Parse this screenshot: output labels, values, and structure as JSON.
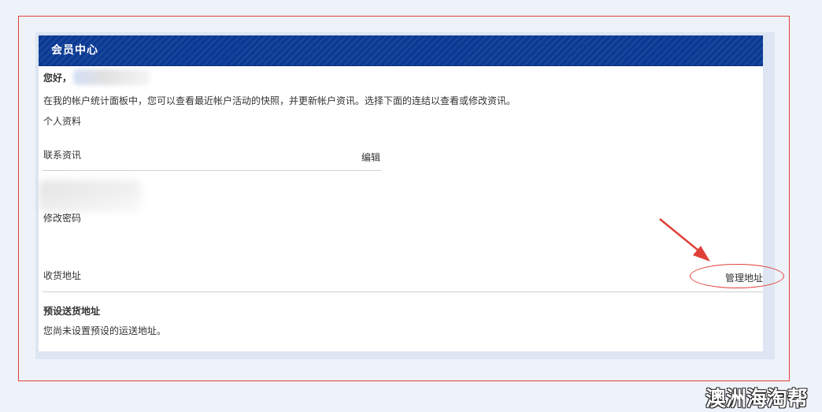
{
  "panel": {
    "title": "会员中心",
    "greeting": "您好，",
    "description": "在我的帐户统计面板中，您可以查看最近帐户活动的快照，并更新帐户资讯。选择下面的连结以查看或修改资讯。",
    "profile_label": "个人资料"
  },
  "contact": {
    "title": "联系资讯",
    "edit_label": "编辑",
    "change_password_label": "修改密码"
  },
  "address": {
    "title": "收货地址",
    "manage_label": "管理地址",
    "default_title": "预设送货地址",
    "no_default_text": "您尚未设置预设的运送地址。"
  },
  "watermark": {
    "text": "澳洲海淘帮"
  },
  "colors": {
    "header_bg": "#0b3a94",
    "annotation_red": "#e0403a",
    "page_bg": "#eef2f9"
  }
}
